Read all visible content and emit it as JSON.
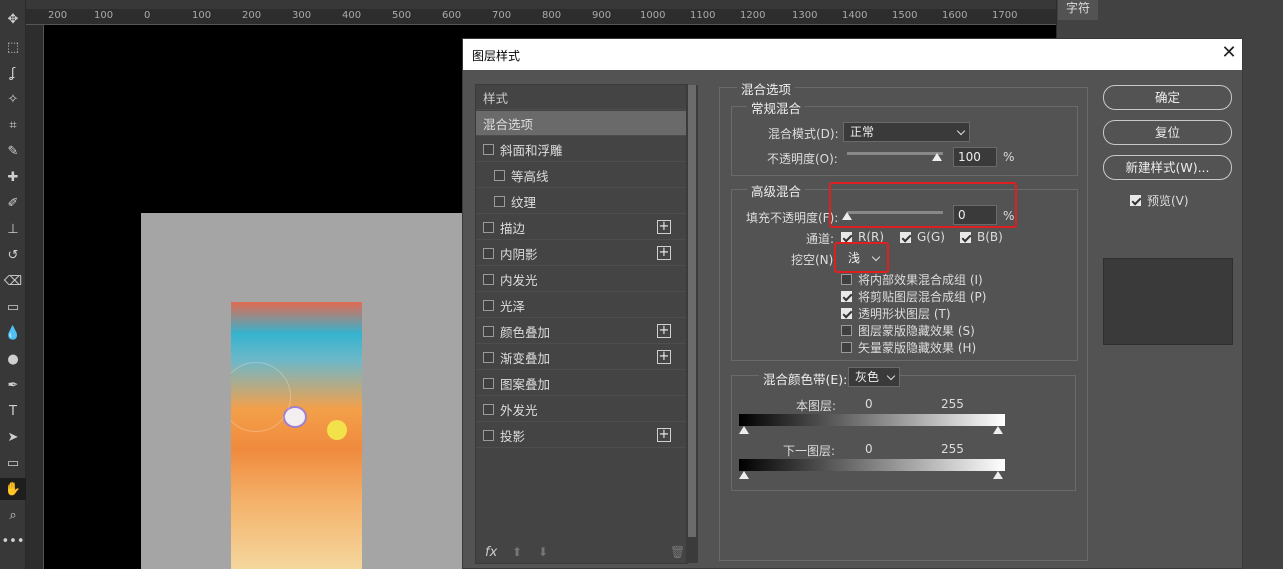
{
  "workspace": {
    "ruler_ticks": [
      "200",
      "100",
      "0",
      "100",
      "200",
      "300",
      "400",
      "500",
      "600",
      "700",
      "800",
      "900",
      "1000",
      "1100",
      "1200",
      "1300",
      "1400",
      "1500",
      "1600",
      "1700"
    ],
    "right_panel_tab": "字符"
  },
  "dialog": {
    "title": "图层样式",
    "styles_header": "样式",
    "styles": [
      {
        "label": "混合选项",
        "checkbox": false,
        "plus": false,
        "selected": true
      },
      {
        "label": "斜面和浮雕",
        "checkbox": true,
        "plus": false
      },
      {
        "label": "等高线",
        "checkbox": true,
        "plus": false,
        "indent": true
      },
      {
        "label": "纹理",
        "checkbox": true,
        "plus": false,
        "indent": true
      },
      {
        "label": "描边",
        "checkbox": true,
        "plus": true
      },
      {
        "label": "内阴影",
        "checkbox": true,
        "plus": true
      },
      {
        "label": "内发光",
        "checkbox": true,
        "plus": false
      },
      {
        "label": "光泽",
        "checkbox": true,
        "plus": false
      },
      {
        "label": "颜色叠加",
        "checkbox": true,
        "plus": true
      },
      {
        "label": "渐变叠加",
        "checkbox": true,
        "plus": true
      },
      {
        "label": "图案叠加",
        "checkbox": true,
        "plus": false
      },
      {
        "label": "外发光",
        "checkbox": true,
        "plus": false
      },
      {
        "label": "投影",
        "checkbox": true,
        "plus": true
      }
    ],
    "footer_fx": "fx",
    "blend_options": {
      "title": "混合选项",
      "general": {
        "title": "常规混合",
        "mode_label": "混合模式(D):",
        "mode_value": "正常",
        "opacity_label": "不透明度(O):",
        "opacity_value": "100",
        "opacity_fraction": 1.0,
        "percent": "%"
      },
      "advanced": {
        "title": "高级混合",
        "fill_label": "填充不透明度(F):",
        "fill_value": "0",
        "fill_fraction": 0.0,
        "percent": "%",
        "channels_label": "通道:",
        "channel_r": "R(R)",
        "channel_g": "G(G)",
        "channel_b": "B(B)",
        "knockout_label": "挖空(N):",
        "knockout_value": "浅",
        "options": [
          {
            "label": "将内部效果混合成组 (I)",
            "checked": false
          },
          {
            "label": "将剪贴图层混合成组 (P)",
            "checked": true
          },
          {
            "label": "透明形状图层 (T)",
            "checked": true
          },
          {
            "label": "图层蒙版隐藏效果 (S)",
            "checked": false
          },
          {
            "label": "矢量蒙版隐藏效果 (H)",
            "checked": false
          }
        ]
      },
      "blend_if": {
        "label": "混合颜色带(E):",
        "value": "灰色",
        "this_layer_label": "本图层:",
        "this_min": "0",
        "this_max": "255",
        "under_layer_label": "下一图层:",
        "under_min": "0",
        "under_max": "255"
      }
    },
    "buttons": {
      "ok": "确定",
      "reset": "复位",
      "new_style": "新建样式(W)...",
      "preview": "预览(V)"
    }
  }
}
